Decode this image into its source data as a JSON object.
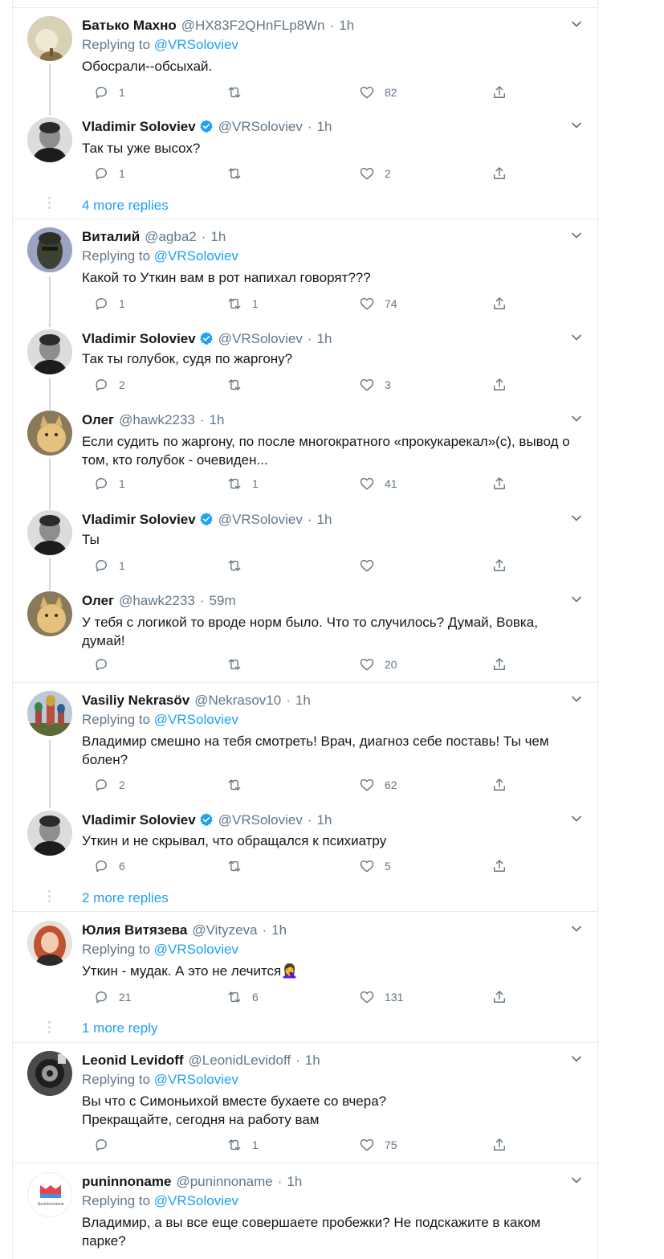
{
  "more_replies": {
    "t1": "4 more replies",
    "t2": "2 more replies",
    "t3": "1 more reply"
  },
  "tweets": [
    {
      "name": "Батько Махно",
      "handle": "@HX83F2QHnFLp8Wn",
      "time": "1h",
      "replying_label": "Replying to",
      "replying_to": "@VRSoloviev",
      "text": "Обосрали--обсыхай.",
      "replies": "1",
      "retweets": "",
      "likes": "82"
    },
    {
      "name": "Vladimir Soloviev",
      "handle": "@VRSoloviev",
      "time": "1h",
      "text": "Так ты уже высох?",
      "replies": "1",
      "retweets": "",
      "likes": "2"
    },
    {
      "name": "Виталий",
      "handle": "@agba2",
      "time": "1h",
      "replying_label": "Replying to",
      "replying_to": "@VRSoloviev",
      "text": "Какой то Уткин вам в рот напихал говорят???",
      "replies": "1",
      "retweets": "1",
      "likes": "74"
    },
    {
      "name": "Vladimir Soloviev",
      "handle": "@VRSoloviev",
      "time": "1h",
      "text": "Так ты голубок, судя по жаргону?",
      "replies": "2",
      "retweets": "",
      "likes": "3"
    },
    {
      "name": "Олег",
      "handle": "@hawk2233",
      "time": "1h",
      "text": "Если судить по жаргону, по после многократного «прокукарекал»(с), вывод о том, кто голубок - очевиден...",
      "replies": "1",
      "retweets": "1",
      "likes": "41"
    },
    {
      "name": "Vladimir Soloviev",
      "handle": "@VRSoloviev",
      "time": "1h",
      "text": "Ты",
      "replies": "1",
      "retweets": "",
      "likes": ""
    },
    {
      "name": "Олег",
      "handle": "@hawk2233",
      "time": "59m",
      "text": "У тебя с логикой то вроде норм было. Что то случилось? Думай, Вовка, думай!",
      "replies": "",
      "retweets": "",
      "likes": "20"
    },
    {
      "name": "Vasiliy Nekrasöv",
      "handle": "@Nekrasov10",
      "time": "1h",
      "replying_label": "Replying to",
      "replying_to": "@VRSoloviev",
      "text": "Владимир смешно на тебя смотреть! Врач, диагноз себе поставь! Ты чем болен?",
      "replies": "2",
      "retweets": "",
      "likes": "62"
    },
    {
      "name": "Vladimir Soloviev",
      "handle": "@VRSoloviev",
      "time": "1h",
      "text": "Уткин и не скрывал, что обращался к психиатру",
      "replies": "6",
      "retweets": "",
      "likes": "5"
    },
    {
      "name": "Юлия Витязева",
      "handle": "@Vityzeva",
      "time": "1h",
      "replying_label": "Replying to",
      "replying_to": "@VRSoloviev",
      "text": "Уткин - мудак. А это не лечится🤦‍♀️",
      "replies": "21",
      "retweets": "6",
      "likes": "131"
    },
    {
      "name": "Leonid Levidoff",
      "handle": "@LeonidLevidoff",
      "time": "1h",
      "replying_label": "Replying to",
      "replying_to": "@VRSoloviev",
      "text": "Вы что с Симоньихой вместе бухаете со вчера?",
      "text2": "Прекращайте, сегодня на работу вам",
      "replies": "",
      "retweets": "1",
      "likes": "75"
    },
    {
      "name": "puninnoname",
      "handle": "@puninnoname",
      "time": "1h",
      "replying_label": "Replying to",
      "replying_to": "@VRSoloviev",
      "text": "Владимир, а вы все еще совершаете пробежки? Не подскажите в каком парке?",
      "avatar_caption": "#puninnoname"
    }
  ],
  "icons": {
    "reply": "reply-icon",
    "retweet": "retweet-icon",
    "like": "heart-icon",
    "share": "share-icon",
    "verified": "verified-badge-icon",
    "caret": "chevron-down-icon"
  },
  "colors": {
    "accent": "#1da1f2",
    "muted": "#657786",
    "border": "#e6ecf0"
  }
}
